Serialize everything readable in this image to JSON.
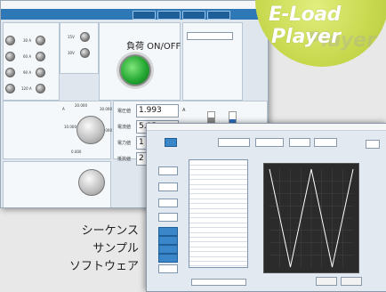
{
  "badge": {
    "line1": "E-Load",
    "line2": "Player",
    "ghost": "Player"
  },
  "caption": {
    "line1": "シーケンス",
    "line2": "サンプル",
    "line3": "ソフトウェア"
  },
  "main_window": {
    "ribbon_buttons": [
      "",
      "",
      "",
      ""
    ],
    "onoff_label": "負荷 ON/OFF",
    "led_labels_left": [
      "30 A",
      "60 A",
      "90 A",
      "120 A"
    ],
    "led_labels_mid": [
      "15V",
      "30V"
    ],
    "readings": [
      {
        "label": "電圧値",
        "value": "1.993",
        "unit": "A"
      },
      {
        "label": "電流値",
        "value": "5.05",
        "unit": "V"
      },
      {
        "label": "電力値",
        "value": "1",
        "unit": ""
      },
      {
        "label": "抵抗値",
        "value": "2",
        "unit": ""
      }
    ],
    "knob_scale": [
      "20.000",
      "30.000",
      "10.000",
      "0.000",
      "40.000"
    ],
    "unit_a": "A"
  },
  "colors": {
    "ribbon": "#2f78b8",
    "led_on": "#25a833",
    "badge": "#c7d84d",
    "graph_bg": "#2b2b2b",
    "graph_line": "#ffffff"
  },
  "chart_data": {
    "type": "line",
    "title": "",
    "xlabel": "",
    "ylabel": "",
    "series": [
      {
        "x": [
          0,
          1,
          2,
          3,
          4
        ],
        "values": [
          1,
          0,
          1,
          0,
          1
        ]
      }
    ]
  }
}
